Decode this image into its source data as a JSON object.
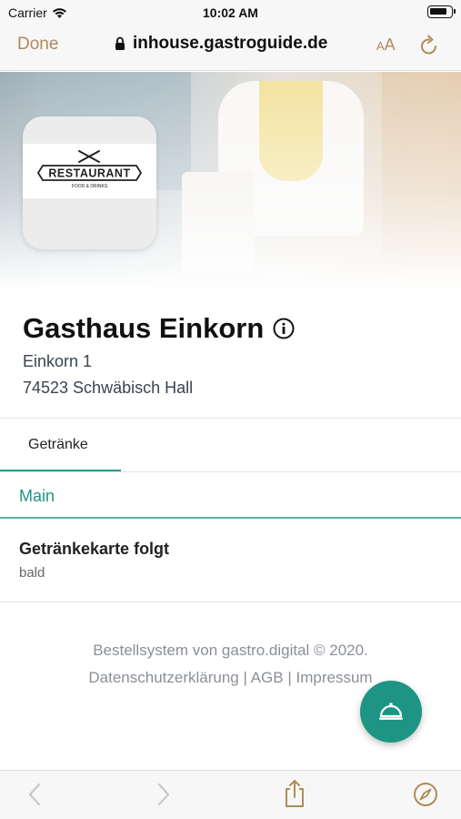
{
  "status_bar": {
    "carrier": "Carrier",
    "time": "10:02 AM",
    "icons": [
      "wifi-icon",
      "battery-icon"
    ]
  },
  "browser": {
    "done_label": "Done",
    "url": "inhouse.gastroguide.de",
    "text_size_small": "A",
    "text_size_large": "A",
    "accent_color": "#b08a5a"
  },
  "logo": {
    "text": "RESTAURANT",
    "subtext": "FOOD & DRINKS"
  },
  "restaurant": {
    "name": "Gasthaus Einkorn",
    "street": "Einkorn 1",
    "city": "74523 Schwäbisch Hall"
  },
  "tabs": [
    {
      "label": "Getränke",
      "active": true
    }
  ],
  "menu": {
    "section": "Main",
    "items": [
      {
        "title": "Getränkekarte folgt",
        "subtitle": "bald"
      }
    ]
  },
  "footer": {
    "line1": "Bestellsystem von gastro.digital © 2020.",
    "privacy": "Datenschutzerklärung",
    "sep1": "|",
    "terms": "AGB",
    "sep2": "|",
    "imprint": "Impressum"
  },
  "colors": {
    "brand_teal": "#1e9484",
    "text_dark": "#111111",
    "muted": "#8a8f96"
  }
}
